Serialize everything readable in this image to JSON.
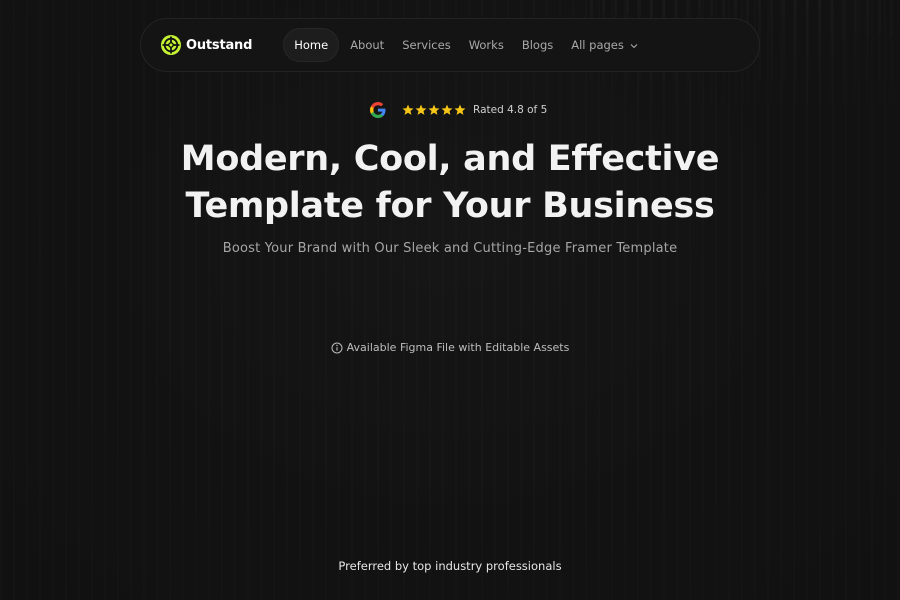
{
  "brand": {
    "name": "Outstand",
    "accent_color": "#c6f432"
  },
  "nav": {
    "items": [
      {
        "label": "Home",
        "active": true
      },
      {
        "label": "About",
        "active": false
      },
      {
        "label": "Services",
        "active": false
      },
      {
        "label": "Works",
        "active": false
      },
      {
        "label": "Blogs",
        "active": false
      },
      {
        "label": "All pages",
        "active": false,
        "has_dropdown": true
      }
    ]
  },
  "rating": {
    "icon": "google-icon",
    "stars": 5,
    "star_color": "#f5c518",
    "text": "Rated 4.8 of 5"
  },
  "hero": {
    "title_line1": "Modern, Cool, and Effective",
    "title_line2": "Template for Your Business",
    "subtitle": "Boost Your Brand with Our Sleek and Cutting-Edge Framer Template"
  },
  "figma_note": {
    "icon": "info-icon",
    "text": "Available Figma File with Editable Assets"
  },
  "footer": {
    "preferred_text": "Preferred by top industry professionals"
  }
}
